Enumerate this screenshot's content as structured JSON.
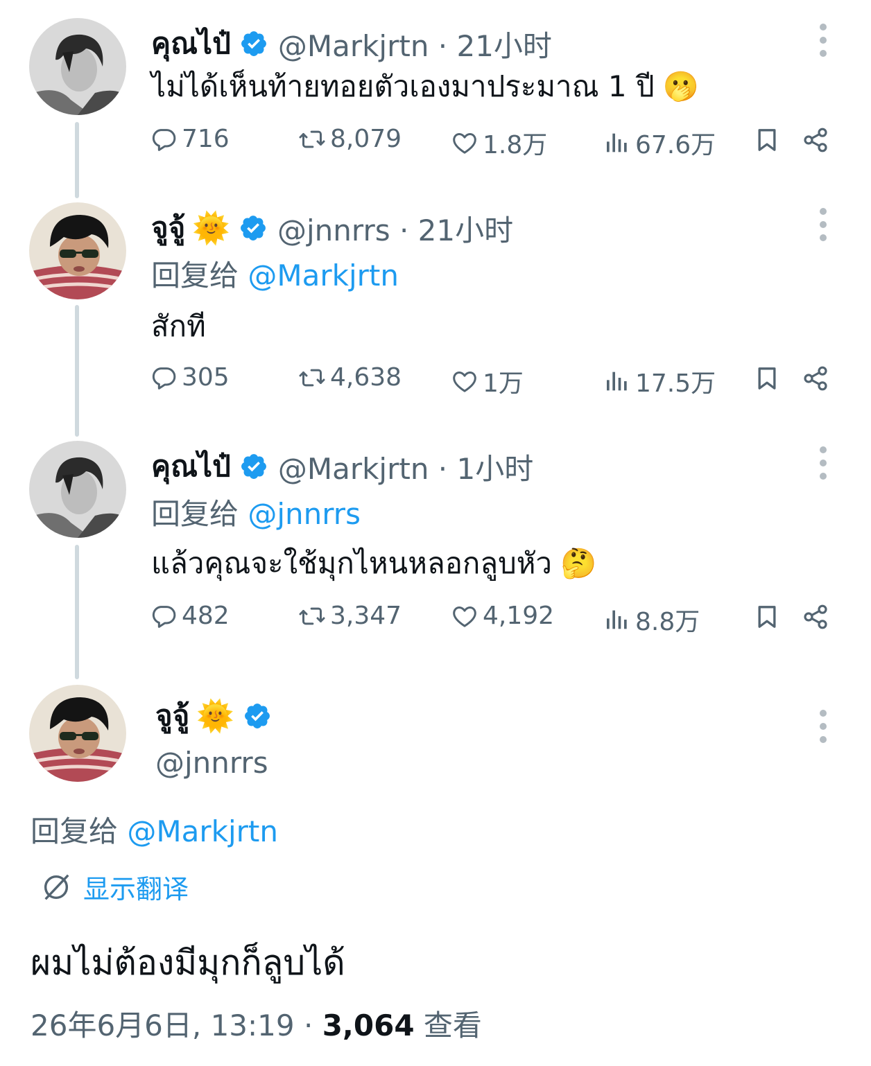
{
  "colors": {
    "accent": "#1d9bf0",
    "muted": "#536471",
    "text": "#0f1419",
    "line": "#cfd9de"
  },
  "tweets": [
    {
      "name": "คุณไป๋",
      "handle_meta": "@Markjrtn · 21小时",
      "text": "ไม่ได้เห็นท้ายทอยตัวเองมาประมาณ 1 ปี",
      "emoji": "🫢",
      "replies": "716",
      "retweets": "8,079",
      "likes": "1.8万",
      "views": "67.6万"
    },
    {
      "name": "จูจู้",
      "sun": "🌞",
      "handle_meta": "@jnnrrs · 21小时",
      "reply_prefix": "回复给",
      "reply_mention": "@Markjrtn",
      "text": "สักที",
      "replies": "305",
      "retweets": "4,638",
      "likes": "1万",
      "views": "17.5万"
    },
    {
      "name": "คุณไป๋",
      "handle_meta": "@Markjrtn · 1小时",
      "reply_prefix": "回复给",
      "reply_mention": "@jnnrrs",
      "text": "แล้วคุณจะใช้มุกไหนหลอกลูบหัว",
      "emoji": "🤔",
      "replies": "482",
      "retweets": "3,347",
      "likes": "4,192",
      "views": "8.8万"
    }
  ],
  "main": {
    "name": "จูจู้",
    "sun": "🌞",
    "handle": "@jnnrrs",
    "reply_prefix": "回复给",
    "reply_mention": "@Markjrtn",
    "translate_label": "显示翻译",
    "text": "ผมไม่ต้องมีมุกก็ลูบได้",
    "datetime": "26年6月6日, 13:19 · ",
    "views_count": "3,064",
    "views_label": " 查看"
  }
}
